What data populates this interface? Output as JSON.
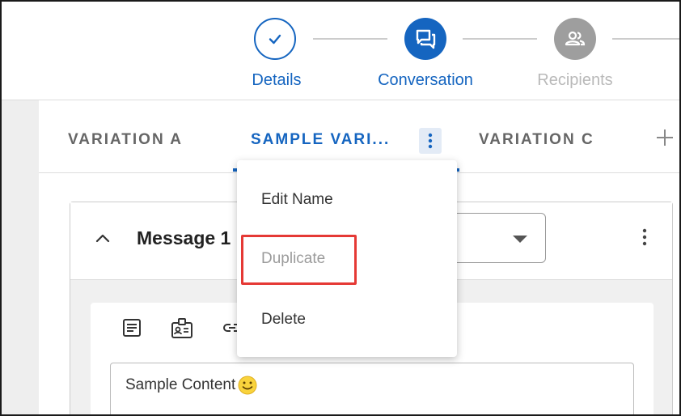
{
  "stepper": {
    "steps": [
      {
        "label": "Details",
        "state": "completed",
        "icon": "check-icon"
      },
      {
        "label": "Conversation",
        "state": "active",
        "icon": "conversation-icon"
      },
      {
        "label": "Recipients",
        "state": "pending",
        "icon": "people-icon"
      }
    ]
  },
  "tabs": {
    "items": [
      {
        "label": "VARIATION A"
      },
      {
        "label": "SAMPLE VARI..."
      },
      {
        "label": "VARIATION C"
      }
    ],
    "active_index": 1,
    "add_icon": "plus-icon",
    "more_icon": "kebab-icon"
  },
  "tab_menu": {
    "items": [
      {
        "label": "Edit Name"
      },
      {
        "label": "Duplicate"
      },
      {
        "label": "Delete"
      }
    ],
    "highlighted_index": 1
  },
  "message_card": {
    "title": "Message 1",
    "collapse_icon": "chevron-up-icon",
    "more_icon": "kebab-icon",
    "toolbar_icons": [
      "text-format-icon",
      "contact-card-icon",
      "link-icon"
    ],
    "content_text": "Sample Content",
    "content_emoji": "smiley-icon"
  },
  "colors": {
    "accent": "#1565c0",
    "highlight": "#e53935",
    "pending": "#9e9e9e"
  }
}
